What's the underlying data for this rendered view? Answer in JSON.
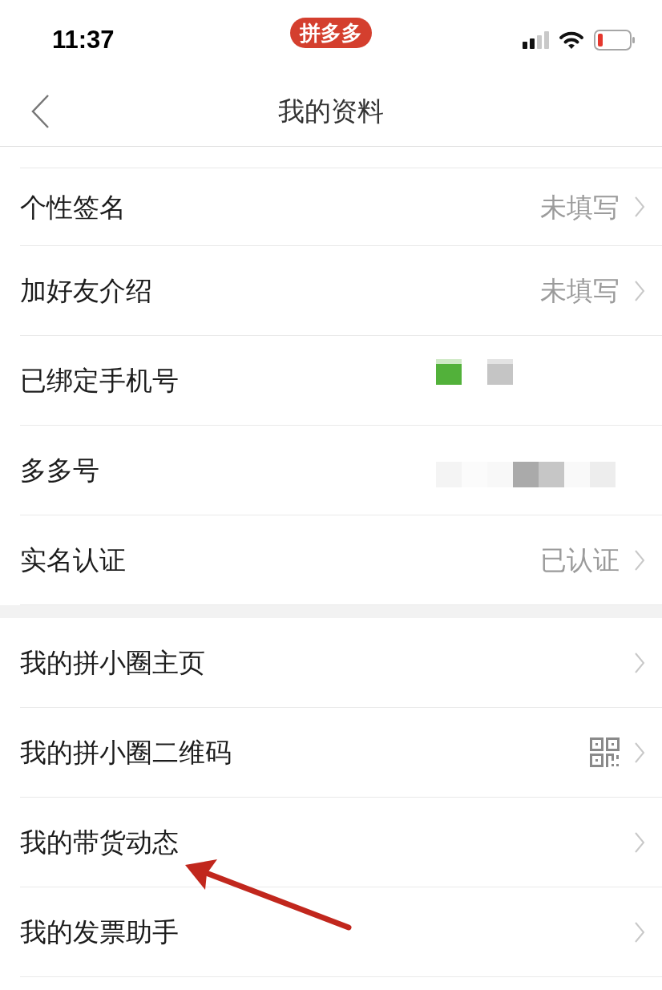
{
  "status_bar": {
    "time": "11:37",
    "app_badge": "拼多多"
  },
  "nav_bar": {
    "title": "我的资料"
  },
  "sections": [
    {
      "rows": [
        {
          "kind": "text",
          "label": "个性签名",
          "value": "未填写",
          "chevron": true,
          "annotated": false
        },
        {
          "kind": "text",
          "label": "加好友介绍",
          "value": "未填写",
          "chevron": true,
          "annotated": false
        },
        {
          "kind": "mosaic",
          "label": "已绑定手机号",
          "chevron": false,
          "annotated": false
        },
        {
          "kind": "mosaic",
          "label": "多多号",
          "chevron": false,
          "annotated": false
        },
        {
          "kind": "text",
          "label": "实名认证",
          "value": "已认证",
          "chevron": true,
          "annotated": false
        }
      ]
    },
    {
      "rows": [
        {
          "kind": "plain",
          "label": "我的拼小圈主页",
          "chevron": true,
          "annotated": false
        },
        {
          "kind": "qr",
          "label": "我的拼小圈二维码",
          "chevron": true,
          "annotated": false
        },
        {
          "kind": "plain",
          "label": "我的带货动态",
          "chevron": true,
          "annotated": true
        },
        {
          "kind": "plain",
          "label": "我的发票助手",
          "chevron": true,
          "annotated": false
        }
      ]
    }
  ]
}
